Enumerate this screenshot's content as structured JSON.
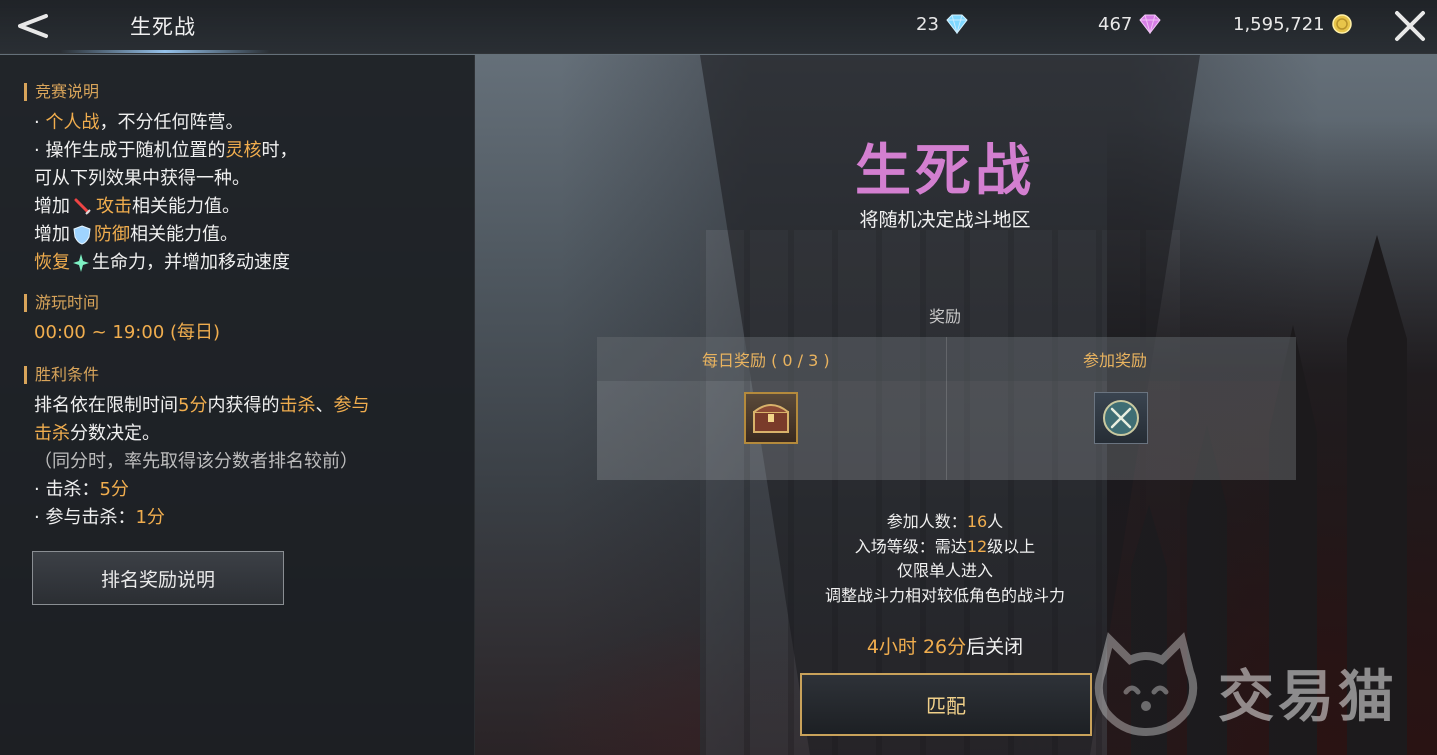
{
  "header": {
    "title": "生死战",
    "currencies": [
      {
        "value": "23",
        "icon": "diamond-blue-icon",
        "color": "#7fd8ff"
      },
      {
        "value": "467",
        "icon": "diamond-purple-icon",
        "color": "#d77ee6"
      },
      {
        "value": "1,595,721",
        "icon": "gold-coin-icon",
        "color": "#e8c54a"
      }
    ]
  },
  "left_panel": {
    "rules": {
      "heading": "竞赛说明",
      "l1_pre": "· ",
      "l1_hl": "个人战",
      "l1_post": "，不分任何阵营。",
      "l2_pre": "· 操作生成于随机位置的",
      "l2_hl": "灵核",
      "l2_post": "时，",
      "l3": "可从下列效果中获得一种。",
      "l4_pre": "增加",
      "l4_hl": "攻击",
      "l4_post": "相关能力值。",
      "l5_pre": "增加",
      "l5_hl": "防御",
      "l5_post": "相关能力值。",
      "l6_hl": "恢复",
      "l6_post": "生命力，并增加移动速度"
    },
    "playtime": {
      "heading": "游玩时间",
      "value": "00:00 ~ 19:00 (每日)"
    },
    "victory": {
      "heading": "胜利条件",
      "l1_pre": "排名依在限制时间",
      "l1_hl1": "5分",
      "l1_mid": "内获得的",
      "l1_hl2": "击杀",
      "l1_sep": "、",
      "l1_hl3": "参与",
      "l2_hl": "击杀",
      "l2_post": "分数决定。",
      "l3": "（同分时，率先取得该分数者排名较前）",
      "l4_pre": "· 击杀：",
      "l4_hl": "5分",
      "l5_pre": "· 参与击杀：",
      "l5_hl": "1分"
    },
    "rank_button_label": "排名奖励说明"
  },
  "main": {
    "title": "生死战",
    "subtitle": "将随机决定战斗地区",
    "reward_label": "奖励",
    "daily_reward_label": "每日奖励 ( 0 / 3 )",
    "join_reward_label": "参加奖励",
    "participants_pre": "参加人数：",
    "participants_value": "16",
    "participants_unit": "人",
    "level_pre": "入场等级：需达",
    "level_value": "12",
    "level_post": "级以上",
    "solo_only": "仅限单人进入",
    "power_adjust": "调整战斗力相对较低角色的战斗力",
    "countdown_value": "4小时 26分",
    "countdown_post": "后关闭",
    "match_button_label": "匹配"
  },
  "watermark": {
    "text": "交易猫"
  },
  "colors": {
    "accent_gold": "#f0ad4e",
    "title_purple": "#d37fd0",
    "section_orange": "#d8a45a"
  }
}
